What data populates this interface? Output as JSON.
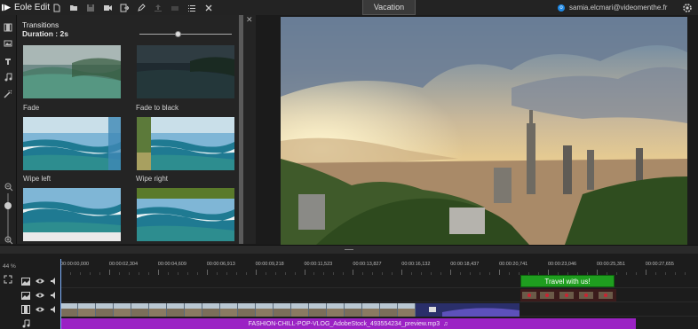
{
  "app": {
    "name": "Eole Edit"
  },
  "toolbar": {
    "tools": [
      "new-file-icon",
      "open-folder-icon",
      "save-icon",
      "import-media-icon",
      "export-icon",
      "edit-icon",
      "upload-icon",
      "share-icon",
      "list-icon",
      "close-icon"
    ]
  },
  "project": {
    "title": "Vacation"
  },
  "user": {
    "badge": "o",
    "email": "samia.elcmari@videomenthe.fr"
  },
  "side_rail": [
    "film-icon",
    "image-icon",
    "text-icon",
    "music-icon",
    "magic-wand-icon"
  ],
  "transitions": {
    "title": "Transitions",
    "duration_label": "Duration : 2s",
    "duration_fraction": 0.4,
    "items": [
      {
        "label": ""
      },
      {
        "label": ""
      },
      {
        "label": "Fade"
      },
      {
        "label": "Fade to black"
      },
      {
        "label": "Wipe left"
      },
      {
        "label": "Wipe right"
      }
    ]
  },
  "timeline": {
    "zoom_percent": "44 %",
    "timecodes": [
      "00:00:00,000",
      "00:00:02,304",
      "00:00:04,609",
      "00:00:06,913",
      "00:00:09,218",
      "00:00:11,523",
      "00:00:13,827",
      "00:00:16,132",
      "00:00:18,437",
      "00:00:20,741",
      "00:00:23,046",
      "00:00:25,351",
      "00:00:27,655"
    ],
    "text_clip": "Travel with us!",
    "audio_clip": "FASHION-CHILL-POP-VLOG_AdobeStock_493554234_preview.mp3"
  },
  "colors": {
    "text_clip": "#1f9e1f",
    "audio_clip": "#9b22c4",
    "accent": "#1e88e5"
  }
}
